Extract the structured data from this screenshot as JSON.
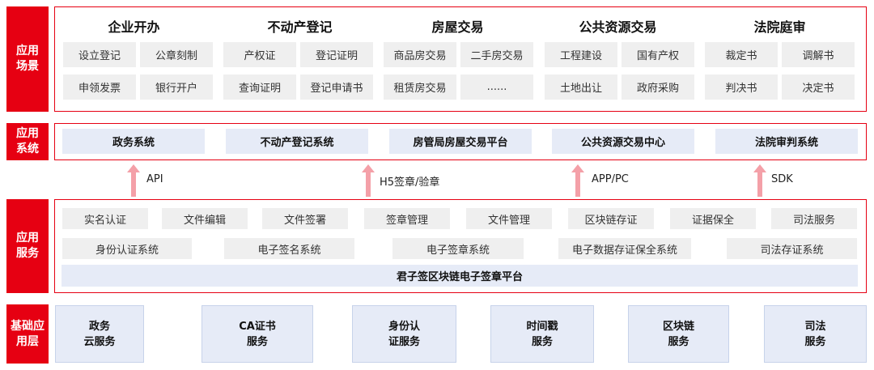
{
  "layers": {
    "scenarios": "应用\n场景",
    "systems": "应用\n系统",
    "services": "应用\n服务",
    "base": "基础应\n用层"
  },
  "scenario_columns": [
    {
      "title": "企业开办",
      "items": [
        "设立登记",
        "公章刻制",
        "申领发票",
        "银行开户"
      ]
    },
    {
      "title": "不动产登记",
      "items": [
        "产权证",
        "登记证明",
        "查询证明",
        "登记申请书"
      ]
    },
    {
      "title": "房屋交易",
      "items": [
        "商品房交易",
        "二手房交易",
        "租赁房交易",
        "......"
      ]
    },
    {
      "title": "公共资源交易",
      "items": [
        "工程建设",
        "国有产权",
        "土地出让",
        "政府采购"
      ]
    },
    {
      "title": "法院庭审",
      "items": [
        "裁定书",
        "调解书",
        "判决书",
        "决定书"
      ]
    }
  ],
  "systems": [
    "政务系统",
    "不动产登记系统",
    "房管局房屋交易平台",
    "公共资源交易中心",
    "法院审判系统"
  ],
  "interfaces": [
    "API",
    "H5签章/验章",
    "APP/PC",
    "SDK"
  ],
  "services_row1": [
    "实名认证",
    "文件编辑",
    "文件签署",
    "签章管理",
    "文件管理",
    "区块链存证",
    "证据保全",
    "司法服务"
  ],
  "services_row2": [
    "身份认证系统",
    "电子签名系统",
    "电子签章系统",
    "电子数据存证保全系统",
    "司法存证系统"
  ],
  "platform": "君子签区块链电子签章平台",
  "base_services": [
    {
      "line1": "政务",
      "line2": "云服务"
    },
    {
      "line1": "CA证书",
      "line2": "服务"
    },
    {
      "line1": "身份认",
      "line2": "证服务"
    },
    {
      "line1": "时间戳",
      "line2": "服务"
    },
    {
      "line1": "区块链",
      "line2": "服务"
    },
    {
      "line1": "司法",
      "line2": "服务"
    }
  ],
  "colors": {
    "accent_red": "#e60012",
    "arrow_pink": "#f4a0a8",
    "tile_gray": "#efefef",
    "tile_blue": "#e6ebf7"
  }
}
